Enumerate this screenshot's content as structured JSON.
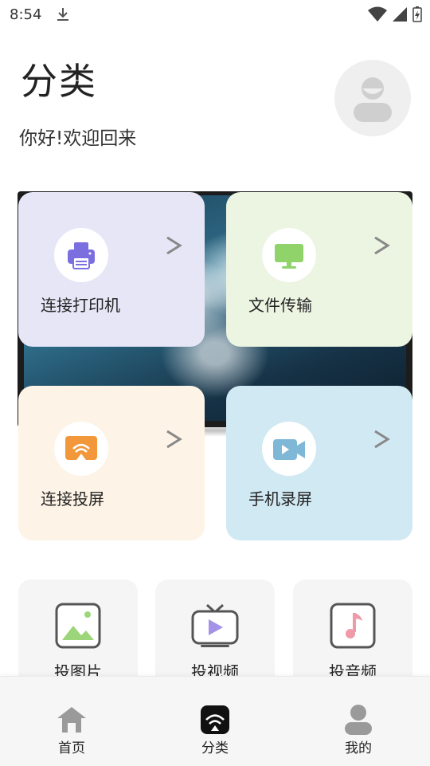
{
  "status_bar": {
    "time": "8:54"
  },
  "header": {
    "title": "分类",
    "greeting": "你好!欢迎回来"
  },
  "feature_cards": [
    {
      "label": "连接打印机",
      "icon": "printer-icon",
      "color": "#e7e6f7"
    },
    {
      "label": "文件传输",
      "icon": "monitor-icon",
      "color": "#ecf4e2"
    },
    {
      "label": "连接投屏",
      "icon": "screen-cast-icon",
      "color": "#fdf3e6"
    },
    {
      "label": "手机录屏",
      "icon": "video-camera-icon",
      "color": "#d1e9f3"
    }
  ],
  "media_cards": [
    {
      "label": "投图片",
      "icon": "image-icon"
    },
    {
      "label": "投视频",
      "icon": "tv-play-icon"
    },
    {
      "label": "投音频",
      "icon": "music-note-icon"
    }
  ],
  "bottom_nav": [
    {
      "label": "首页",
      "icon": "home-icon"
    },
    {
      "label": "分类",
      "icon": "category-icon",
      "active": true
    },
    {
      "label": "我的",
      "icon": "user-icon"
    }
  ],
  "colors": {
    "printer": "#7b6fe0",
    "file": "#8fd36a",
    "cast": "#f2973a",
    "record": "#7fb8d6"
  }
}
